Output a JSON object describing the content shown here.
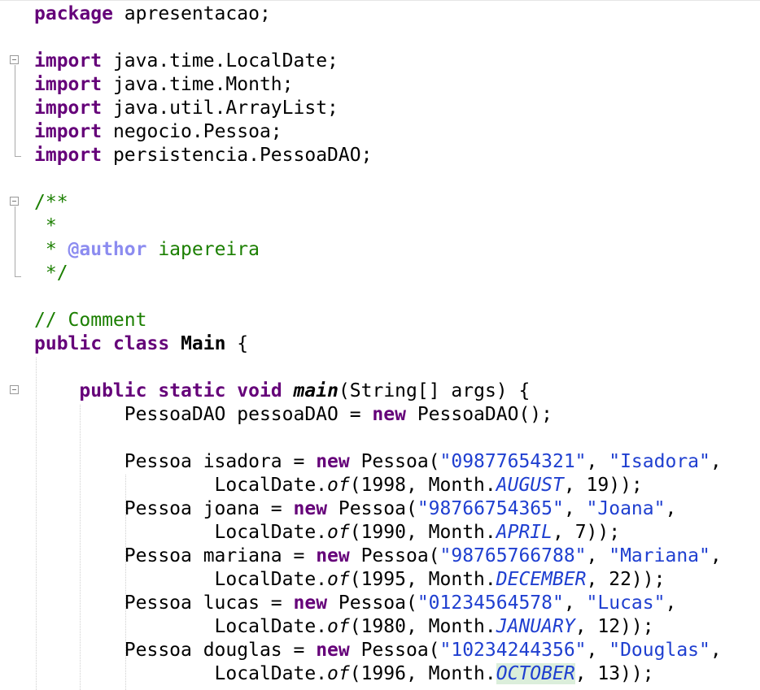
{
  "editor": {
    "lines": [
      {
        "tokens": [
          {
            "t": "package",
            "c": "kw"
          },
          {
            "t": " apresentacao;"
          }
        ]
      },
      {
        "tokens": []
      },
      {
        "tokens": [
          {
            "t": "import",
            "c": "kw"
          },
          {
            "t": " java.time.LocalDate;"
          }
        ]
      },
      {
        "tokens": [
          {
            "t": "import",
            "c": "kw"
          },
          {
            "t": " java.time.Month;"
          }
        ]
      },
      {
        "tokens": [
          {
            "t": "import",
            "c": "kw"
          },
          {
            "t": " java.util.ArrayList;"
          }
        ]
      },
      {
        "tokens": [
          {
            "t": "import",
            "c": "kw"
          },
          {
            "t": " negocio.Pessoa;"
          }
        ]
      },
      {
        "tokens": [
          {
            "t": "import",
            "c": "kw"
          },
          {
            "t": " persistencia.PessoaDAO;"
          }
        ]
      },
      {
        "tokens": []
      },
      {
        "tokens": [
          {
            "t": "/**",
            "c": "cmt"
          }
        ]
      },
      {
        "tokens": [
          {
            "t": " *",
            "c": "cmt"
          }
        ]
      },
      {
        "tokens": [
          {
            "t": " * ",
            "c": "cmt"
          },
          {
            "t": "@author",
            "c": "tag"
          },
          {
            "t": " iapereira",
            "c": "cmt"
          }
        ]
      },
      {
        "tokens": [
          {
            "t": " */",
            "c": "cmt"
          }
        ]
      },
      {
        "tokens": []
      },
      {
        "tokens": [
          {
            "t": "// Comment",
            "c": "cmt"
          }
        ]
      },
      {
        "tokens": [
          {
            "t": "public",
            "c": "kw"
          },
          {
            "t": " "
          },
          {
            "t": "class",
            "c": "kw"
          },
          {
            "t": " "
          },
          {
            "t": "Main",
            "c": "b"
          },
          {
            "t": " {"
          }
        ]
      },
      {
        "tokens": []
      },
      {
        "tokens": [
          {
            "t": "    "
          },
          {
            "t": "public",
            "c": "kw"
          },
          {
            "t": " "
          },
          {
            "t": "static",
            "c": "kw"
          },
          {
            "t": " "
          },
          {
            "t": "void",
            "c": "kw"
          },
          {
            "t": " "
          },
          {
            "t": "main",
            "c": "bi"
          },
          {
            "t": "(String[] args) {"
          }
        ]
      },
      {
        "tokens": [
          {
            "t": "        PessoaDAO pessoaDAO = "
          },
          {
            "t": "new",
            "c": "kw"
          },
          {
            "t": " PessoaDAO();"
          }
        ]
      },
      {
        "tokens": []
      },
      {
        "tokens": [
          {
            "t": "        Pessoa isadora = "
          },
          {
            "t": "new",
            "c": "kw"
          },
          {
            "t": " Pessoa("
          },
          {
            "t": "\"09877654321\"",
            "c": "str"
          },
          {
            "t": ", "
          },
          {
            "t": "\"Isadora\"",
            "c": "str"
          },
          {
            "t": ","
          }
        ]
      },
      {
        "tokens": [
          {
            "t": "                LocalDate."
          },
          {
            "t": "of",
            "c": "it"
          },
          {
            "t": "(1998, Month."
          },
          {
            "t": "AUGUST",
            "c": "fld"
          },
          {
            "t": ", 19));"
          }
        ]
      },
      {
        "tokens": [
          {
            "t": "        Pessoa joana = "
          },
          {
            "t": "new",
            "c": "kw"
          },
          {
            "t": " Pessoa("
          },
          {
            "t": "\"98766754365\"",
            "c": "str"
          },
          {
            "t": ", "
          },
          {
            "t": "\"Joana\"",
            "c": "str"
          },
          {
            "t": ","
          }
        ]
      },
      {
        "tokens": [
          {
            "t": "                LocalDate."
          },
          {
            "t": "of",
            "c": "it"
          },
          {
            "t": "(1990, Month."
          },
          {
            "t": "APRIL",
            "c": "fld"
          },
          {
            "t": ", 7));"
          }
        ]
      },
      {
        "tokens": [
          {
            "t": "        Pessoa mariana = "
          },
          {
            "t": "new",
            "c": "kw"
          },
          {
            "t": " Pessoa("
          },
          {
            "t": "\"98765766788\"",
            "c": "str"
          },
          {
            "t": ", "
          },
          {
            "t": "\"Mariana\"",
            "c": "str"
          },
          {
            "t": ","
          }
        ]
      },
      {
        "tokens": [
          {
            "t": "                LocalDate."
          },
          {
            "t": "of",
            "c": "it"
          },
          {
            "t": "(1995, Month."
          },
          {
            "t": "DECEMBER",
            "c": "fld"
          },
          {
            "t": ", 22));"
          }
        ]
      },
      {
        "tokens": [
          {
            "t": "        Pessoa lucas = "
          },
          {
            "t": "new",
            "c": "kw"
          },
          {
            "t": " Pessoa("
          },
          {
            "t": "\"01234564578\"",
            "c": "str"
          },
          {
            "t": ", "
          },
          {
            "t": "\"Lucas\"",
            "c": "str"
          },
          {
            "t": ","
          }
        ]
      },
      {
        "tokens": [
          {
            "t": "                LocalDate."
          },
          {
            "t": "of",
            "c": "it"
          },
          {
            "t": "(1980, Month."
          },
          {
            "t": "JANUARY",
            "c": "fld"
          },
          {
            "t": ", 12));"
          }
        ]
      },
      {
        "tokens": [
          {
            "t": "        Pessoa douglas = "
          },
          {
            "t": "new",
            "c": "kw"
          },
          {
            "t": " Pessoa("
          },
          {
            "t": "\"10234244356\"",
            "c": "str"
          },
          {
            "t": ", "
          },
          {
            "t": "\"Douglas\"",
            "c": "str"
          },
          {
            "t": ","
          }
        ]
      },
      {
        "tokens": [
          {
            "t": "                LocalDate."
          },
          {
            "t": "of",
            "c": "it"
          },
          {
            "t": "(1996, Month."
          },
          {
            "t": "OCTOBER",
            "c": "fld hl"
          },
          {
            "t": ", 13));"
          }
        ]
      }
    ],
    "colors": {
      "keyword": "#650079",
      "string": "#1f3fd0",
      "comment": "#1b7f00",
      "javadoc_tag": "#8c8cf0",
      "highlight": "#dbeedb"
    }
  }
}
